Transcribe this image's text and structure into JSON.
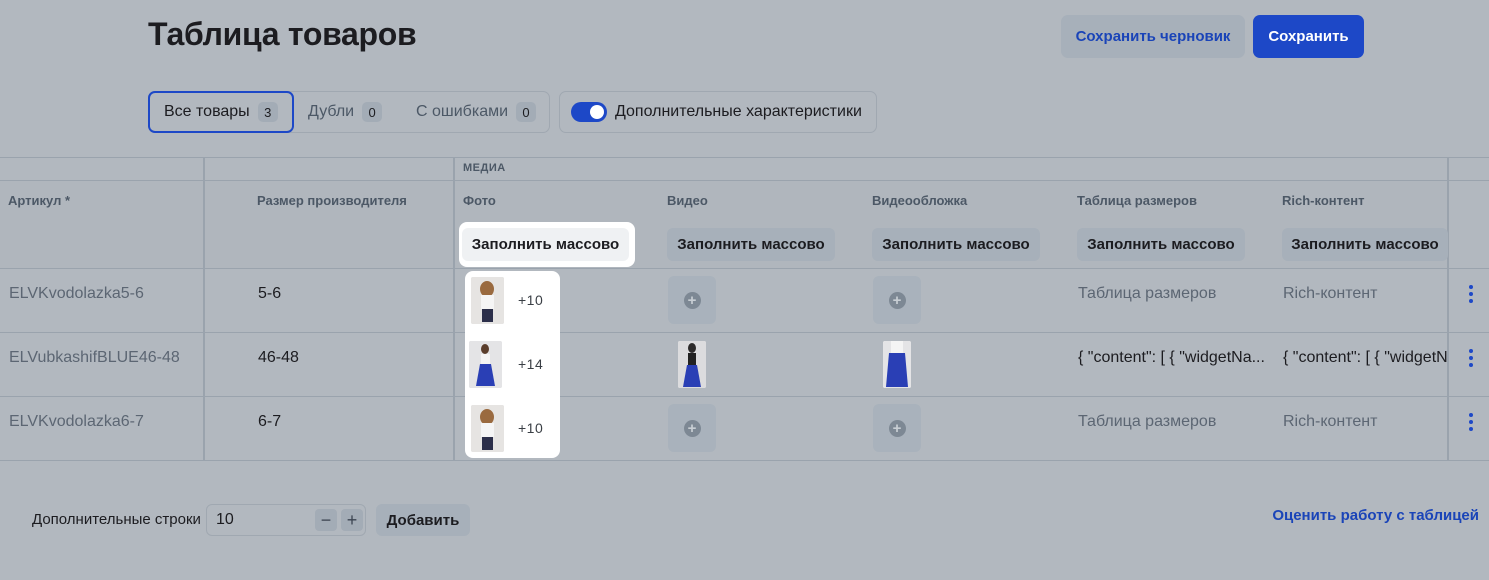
{
  "header": {
    "title": "Таблица товаров",
    "save_draft": "Сохранить черновик",
    "save": "Сохранить"
  },
  "filters": {
    "tabs": [
      {
        "label": "Все товары",
        "count": "3",
        "active": true
      },
      {
        "label": "Дубли",
        "count": "0",
        "active": false
      },
      {
        "label": "С ошибками",
        "count": "0",
        "active": false
      }
    ],
    "extra_toggle": {
      "label": "Дополнительные характеристики",
      "on": true
    }
  },
  "table": {
    "group_label": "МЕДИА",
    "columns": {
      "sku": "Артикул *",
      "size": "Размер производителя",
      "photo": "Фото",
      "video": "Видео",
      "cover": "Видеообложка",
      "size_table": "Таблица размеров",
      "rich": "Rich-контент"
    },
    "fill_label": "Заполнить массово",
    "rows": [
      {
        "sku": "ELVKvodolazka5-6",
        "size": "5-6",
        "photo_more": "+10",
        "size_table": "Таблица размеров",
        "rich": "Rich-контент",
        "size_table_placeholder": true
      },
      {
        "sku": "ELVubkashifBLUE46-48",
        "size": "46-48",
        "photo_more": "+14",
        "size_table": "{ \"content\": [ { \"widgetNa...",
        "rich": "{ \"content\": [ { \"widgetN",
        "size_table_placeholder": false
      },
      {
        "sku": "ELVKvodolazka6-7",
        "size": "6-7",
        "photo_more": "+10",
        "size_table": "Таблица размеров",
        "rich": "Rich-контент",
        "size_table_placeholder": true
      }
    ]
  },
  "footer": {
    "extra_rows_label": "Дополнительные строки",
    "extra_rows_value": "10",
    "add": "Добавить",
    "feedback": "Оценить работу с таблицей"
  },
  "colors": {
    "accent": "#1d48c7",
    "overlay": "#b2b8bf"
  }
}
